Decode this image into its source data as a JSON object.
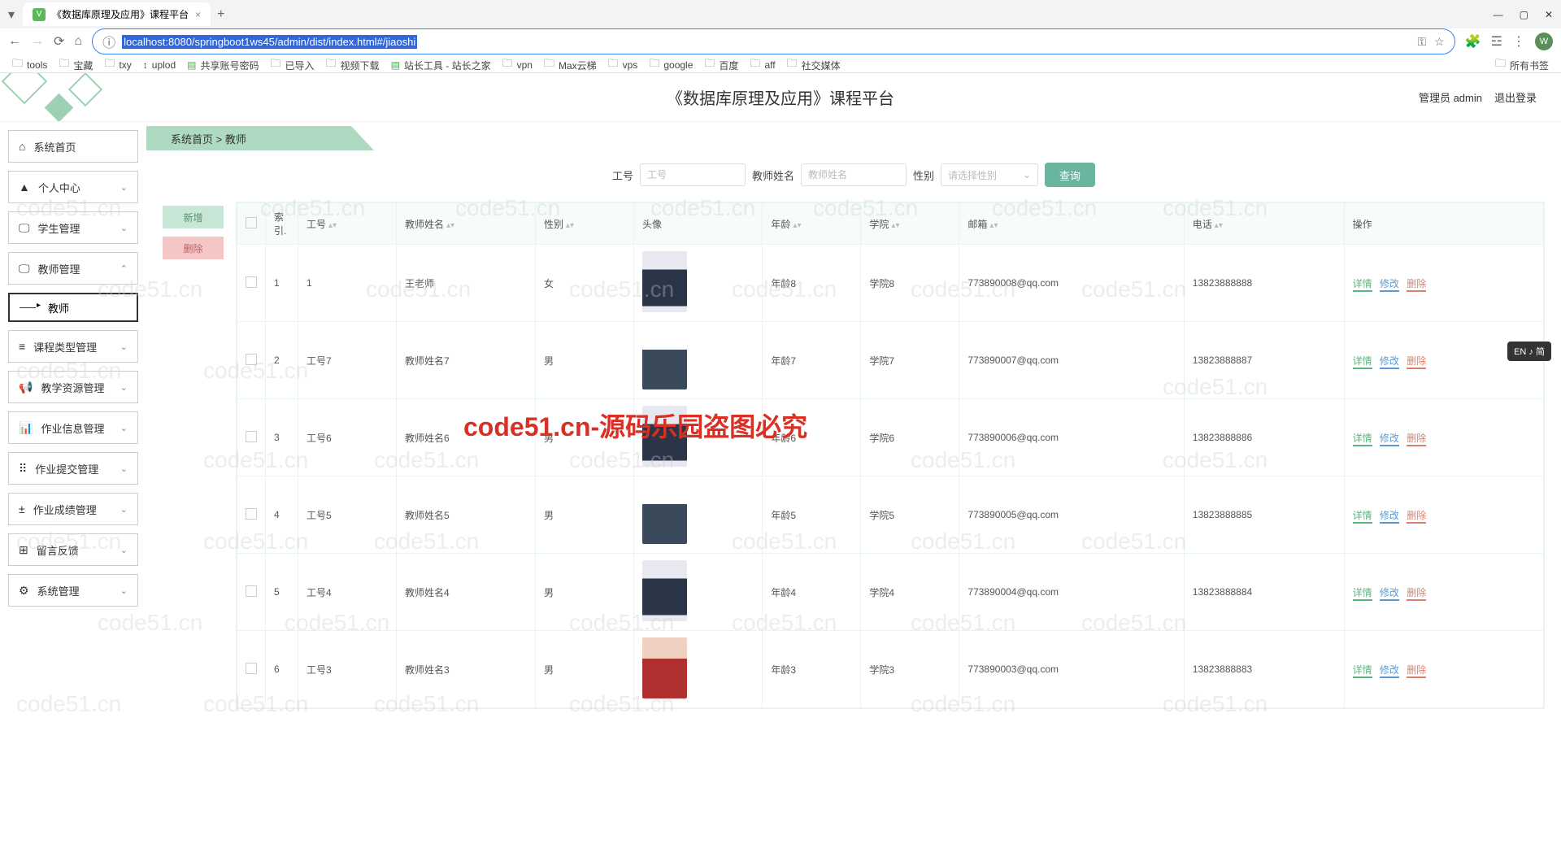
{
  "browser": {
    "tab_title": "《数据库原理及应用》课程平台",
    "url": "localhost:8080/springboot1ws45/admin/dist/index.html#/jiaoshi",
    "bookmarks": [
      "tools",
      "宝藏",
      "txy",
      "uplod",
      "共享账号密码",
      "已导入",
      "视频下载",
      "站长工具 - 站长之家",
      "vpn",
      "Max云梯",
      "vps",
      "google",
      "百度",
      "aff",
      "社交媒体"
    ],
    "bookmark_right": "所有书签"
  },
  "header": {
    "title": "《数据库原理及应用》课程平台",
    "user": "管理员 admin",
    "logout": "退出登录"
  },
  "breadcrumb": {
    "home": "系统首页",
    "sep": ">",
    "current": "教师"
  },
  "sidebar": {
    "items": [
      {
        "icon": "⌂",
        "label": "系统首页",
        "arrow": false
      },
      {
        "icon": "▲",
        "label": "个人中心",
        "arrow": true
      },
      {
        "icon": "🖵",
        "label": "学生管理",
        "arrow": true
      },
      {
        "icon": "🖵",
        "label": "教师管理",
        "arrow": true,
        "expanded": true
      },
      {
        "icon": "≡",
        "label": "课程类型管理",
        "arrow": true
      },
      {
        "icon": "📢",
        "label": "教学资源管理",
        "arrow": true
      },
      {
        "icon": "📊",
        "label": "作业信息管理",
        "arrow": true
      },
      {
        "icon": "⠿",
        "label": "作业提交管理",
        "arrow": true
      },
      {
        "icon": "±",
        "label": "作业成绩管理",
        "arrow": true
      },
      {
        "icon": "⊞",
        "label": "留言反馈",
        "arrow": true
      },
      {
        "icon": "⚙",
        "label": "系统管理",
        "arrow": true
      }
    ],
    "sub_item": "教师"
  },
  "search": {
    "f1_label": "工号",
    "f1_ph": "工号",
    "f2_label": "教师姓名",
    "f2_ph": "教师姓名",
    "f3_label": "性别",
    "f3_ph": "请选择性别",
    "btn": "查询"
  },
  "actions": {
    "add": "新增",
    "del": "删除"
  },
  "table": {
    "headers": [
      "",
      "索引.",
      "工号",
      "教师姓名",
      "性别",
      "头像",
      "年龄",
      "学院",
      "邮箱",
      "电话",
      "操作"
    ],
    "rows": [
      {
        "idx": "1",
        "gh": "1",
        "name": "王老师",
        "sex": "女",
        "age": "年龄8",
        "college": "学院8",
        "email": "773890008@qq.com",
        "phone": "13823888888"
      },
      {
        "idx": "2",
        "gh": "工号7",
        "name": "教师姓名7",
        "sex": "男",
        "age": "年龄7",
        "college": "学院7",
        "email": "773890007@qq.com",
        "phone": "13823888887"
      },
      {
        "idx": "3",
        "gh": "工号6",
        "name": "教师姓名6",
        "sex": "男",
        "age": "年龄6",
        "college": "学院6",
        "email": "773890006@qq.com",
        "phone": "13823888886"
      },
      {
        "idx": "4",
        "gh": "工号5",
        "name": "教师姓名5",
        "sex": "男",
        "age": "年龄5",
        "college": "学院5",
        "email": "773890005@qq.com",
        "phone": "13823888885"
      },
      {
        "idx": "5",
        "gh": "工号4",
        "name": "教师姓名4",
        "sex": "男",
        "age": "年龄4",
        "college": "学院4",
        "email": "773890004@qq.com",
        "phone": "13823888884"
      },
      {
        "idx": "6",
        "gh": "工号3",
        "name": "教师姓名3",
        "sex": "男",
        "age": "年龄3",
        "college": "学院3",
        "email": "773890003@qq.com",
        "phone": "13823888883"
      }
    ],
    "ops": {
      "detail": "详情",
      "edit": "修改",
      "del": "删除"
    }
  },
  "watermark_text": "code51.cn",
  "watermark_red": "code51.cn-源码乐园盗图必究",
  "lang_badge": "EN ♪ 简"
}
